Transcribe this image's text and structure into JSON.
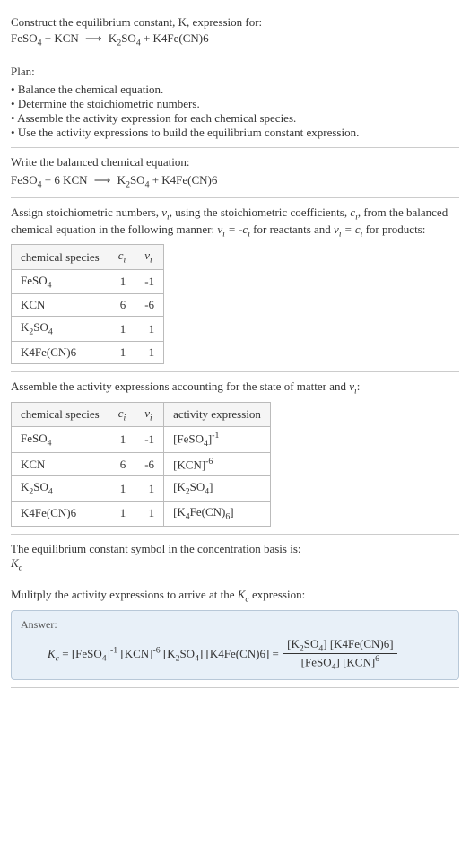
{
  "intro": {
    "line1": "Construct the equilibrium constant, K, expression for:",
    "eq_lhs1": "FeSO",
    "eq_lhs2": " + KCN ",
    "eq_rhs1": " K",
    "eq_rhs2": "SO",
    "eq_rhs3": " + K4Fe(CN)6"
  },
  "plan": {
    "title": "Plan:",
    "items": [
      "Balance the chemical equation.",
      "Determine the stoichiometric numbers.",
      "Assemble the activity expression for each chemical species.",
      "Use the activity expressions to build the equilibrium constant expression."
    ]
  },
  "balanced": {
    "title": "Write the balanced chemical equation:",
    "lhs1": "FeSO",
    "lhs2": " + 6 KCN ",
    "rhs1": " K",
    "rhs2": "SO",
    "rhs3": " + K4Fe(CN)6"
  },
  "assign": {
    "text1": "Assign stoichiometric numbers, ",
    "text2": ", using the stoichiometric coefficients, ",
    "text3": ", from the balanced chemical equation in the following manner: ",
    "text4": " for reactants and ",
    "text5": " for products:",
    "headers": [
      "chemical species",
      "c",
      "ν"
    ],
    "rows": [
      {
        "species": "FeSO",
        "sub": "4",
        "c": "1",
        "v": "-1"
      },
      {
        "species": "KCN",
        "sub": "",
        "c": "6",
        "v": "-6"
      },
      {
        "species": "K",
        "sub2": "2",
        "mid": "SO",
        "sub": "4",
        "c": "1",
        "v": "1"
      },
      {
        "species": "K4Fe(CN)6",
        "sub": "",
        "c": "1",
        "v": "1"
      }
    ]
  },
  "activity": {
    "title": "Assemble the activity expressions accounting for the state of matter and ",
    "headers": [
      "chemical species",
      "c",
      "ν",
      "activity expression"
    ],
    "rows": [
      {
        "sp": "FeSO",
        "sub": "4",
        "c": "1",
        "v": "-1",
        "act": "[FeSO",
        "actsub": "4",
        "actsup": "-1"
      },
      {
        "sp": "KCN",
        "sub": "",
        "c": "6",
        "v": "-6",
        "act": "[KCN]",
        "actsub": "",
        "actsup": "-6"
      },
      {
        "sp": "K",
        "sub2": "2",
        "mid": "SO",
        "sub": "4",
        "c": "1",
        "v": "1",
        "act": "[K",
        "actsub2": "2",
        "actmid": "SO",
        "actsub": "4",
        "actend": "]"
      },
      {
        "sp": "K4Fe(CN)6",
        "sub": "",
        "c": "1",
        "v": "1",
        "act": "[K",
        "actsub2": "4",
        "actmid": "Fe(CN)",
        "actsub": "6",
        "actend": "]"
      }
    ]
  },
  "symbol": {
    "line1": "The equilibrium constant symbol in the concentration basis is:",
    "sym": "K",
    "sub": "c"
  },
  "multiply": {
    "title": "Mulitply the activity expressions to arrive at the ",
    "title2": " expression:"
  },
  "answer": {
    "label": "Answer:",
    "kc": "K",
    "kcsub": "c",
    "eq": " = [FeSO",
    "p1sub": "4",
    "p1sup": "-1",
    "p2": " [KCN]",
    "p2sup": "-6",
    "p3": " [K",
    "p3sub": "2",
    "p3mid": "SO",
    "p3sub2": "4",
    "p3end": "] [K4Fe(CN)6] = ",
    "num1": "[K",
    "numsub1": "2",
    "nummid1": "SO",
    "numsub2": "4",
    "numend1": "] [K4Fe(CN)6]",
    "den1": "[FeSO",
    "densub1": "4",
    "denmid1": "] [KCN]",
    "densup1": "6"
  }
}
